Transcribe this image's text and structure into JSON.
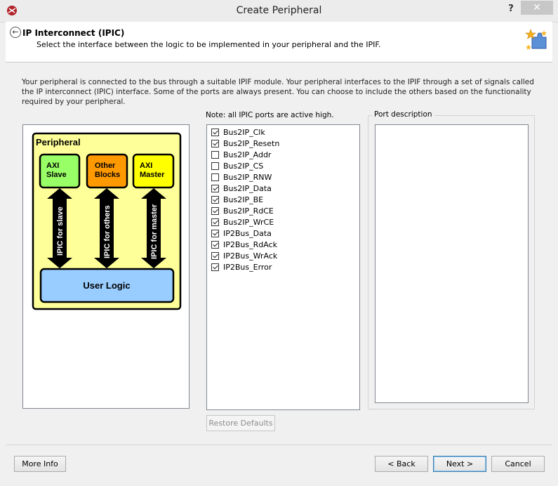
{
  "window": {
    "title": "Create Peripheral",
    "help_glyph": "?",
    "close_glyph": "✕"
  },
  "header": {
    "title": "IP Interconnect (IPIC)",
    "subtitle": "Select the interface between the logic to be implemented in your peripheral and the IPIF."
  },
  "intro_text": "Your peripheral is connected to the bus through a suitable IPIF module. Your peripheral interfaces to the IPIF through a set of signals called the IP interconnect (IPIC) interface. Some of the ports are always present. You can choose to include the others based on the functionality required by your peripheral.",
  "diagram": {
    "peripheral_label": "Peripheral",
    "block_axi_slave": [
      "AXI",
      "Slave"
    ],
    "block_other": [
      "Other",
      "Blocks"
    ],
    "block_axi_master": [
      "AXI",
      "Master"
    ],
    "arrow_slave": "IPIC for slave",
    "arrow_others": "IPIC for others",
    "arrow_master": "IPIC for master",
    "user_logic": "User Logic",
    "colors": {
      "panel": "#ffff99",
      "slave": "#99ff66",
      "other": "#ff9900",
      "master": "#ffff00",
      "user_logic": "#99ccff"
    }
  },
  "ports": {
    "note": "Note: all IPIC ports are active high.",
    "items": [
      {
        "label": "Bus2IP_Clk",
        "checked": true
      },
      {
        "label": "Bus2IP_Resetn",
        "checked": true
      },
      {
        "label": "Bus2IP_Addr",
        "checked": false
      },
      {
        "label": "Bus2IP_CS",
        "checked": false
      },
      {
        "label": "Bus2IP_RNW",
        "checked": false
      },
      {
        "label": "Bus2IP_Data",
        "checked": true
      },
      {
        "label": "Bus2IP_BE",
        "checked": true
      },
      {
        "label": "Bus2IP_RdCE",
        "checked": true
      },
      {
        "label": "Bus2IP_WrCE",
        "checked": true
      },
      {
        "label": "IP2Bus_Data",
        "checked": true
      },
      {
        "label": "IP2Bus_RdAck",
        "checked": true
      },
      {
        "label": "IP2Bus_WrAck",
        "checked": true
      },
      {
        "label": "IP2Bus_Error",
        "checked": true
      }
    ],
    "restore_label": "Restore Defaults"
  },
  "description": {
    "legend": "Port description"
  },
  "footer": {
    "more_info": "More Info",
    "back": "< Back",
    "next": "Next >",
    "cancel": "Cancel"
  }
}
